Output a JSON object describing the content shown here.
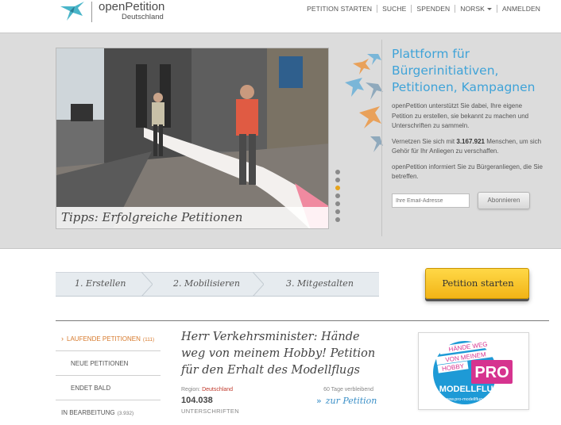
{
  "header": {
    "logo_title": "openPetition",
    "logo_sub": "Deutschland",
    "nav": [
      "PETITION STARTEN",
      "SUCHE",
      "SPENDEN",
      "NORSK",
      "ANMELDEN"
    ]
  },
  "hero": {
    "caption": "Tipps: Erfolgreiche Petitionen",
    "title_lines": [
      "Plattform für",
      "Bürgerinitiativen,",
      "Petitionen, Kampagnen"
    ],
    "p1": "openPetition unterstützt Sie dabei, Ihre eigene Petition zu erstellen, sie bekannt zu machen und Unterschriften zu sammeln.",
    "p2_before": "Vernetzen Sie sich mit ",
    "p2_number": "3.167.921",
    "p2_after": " Menschen, um sich Gehör für Ihr Anliegen zu verschaffen.",
    "p3": "openPetition informiert Sie zu Bürgeranliegen, die Sie betreffen.",
    "email_placeholder": "Ihre Email-Adresse",
    "subscribe_label": "Abonnieren",
    "slides_total": 7,
    "slide_active": 2
  },
  "steps": [
    "1. Erstellen",
    "2. Mobilisieren",
    "3. Mitgestalten"
  ],
  "start_button": "Petition starten",
  "sidebar": [
    {
      "label": "LAUFENDE PETITIONEN",
      "count": "(111)",
      "active": true
    },
    {
      "label": "NEUE PETITIONEN",
      "count": ""
    },
    {
      "label": "ENDET BALD",
      "count": ""
    },
    {
      "label": "IN BEARBEITUNG",
      "count": "(3.932)"
    }
  ],
  "petition": {
    "title": "Herr Verkehrsminister: Hände weg von meinem Hobby! Petition für den Erhalt des Modellflugs",
    "region_label": "Region:",
    "region_value": "Deutschland",
    "remaining": "60 Tage verbleibend",
    "signatures": "104.038",
    "signatures_unit": "UNTERSCHRIFTEN",
    "link": "zur Petition"
  },
  "badge": {
    "line1": "HÄNDE WEG",
    "line2": "VON MEINEM",
    "line3": "HOBBY",
    "pro": "PRO",
    "modellflug": "MODELLFLUG",
    "url": "www.pro-modellflug.de"
  },
  "colors": {
    "accent_blue": "#3fa3d8",
    "accent_orange": "#d77a2c",
    "button_yellow": "#f2b416"
  }
}
